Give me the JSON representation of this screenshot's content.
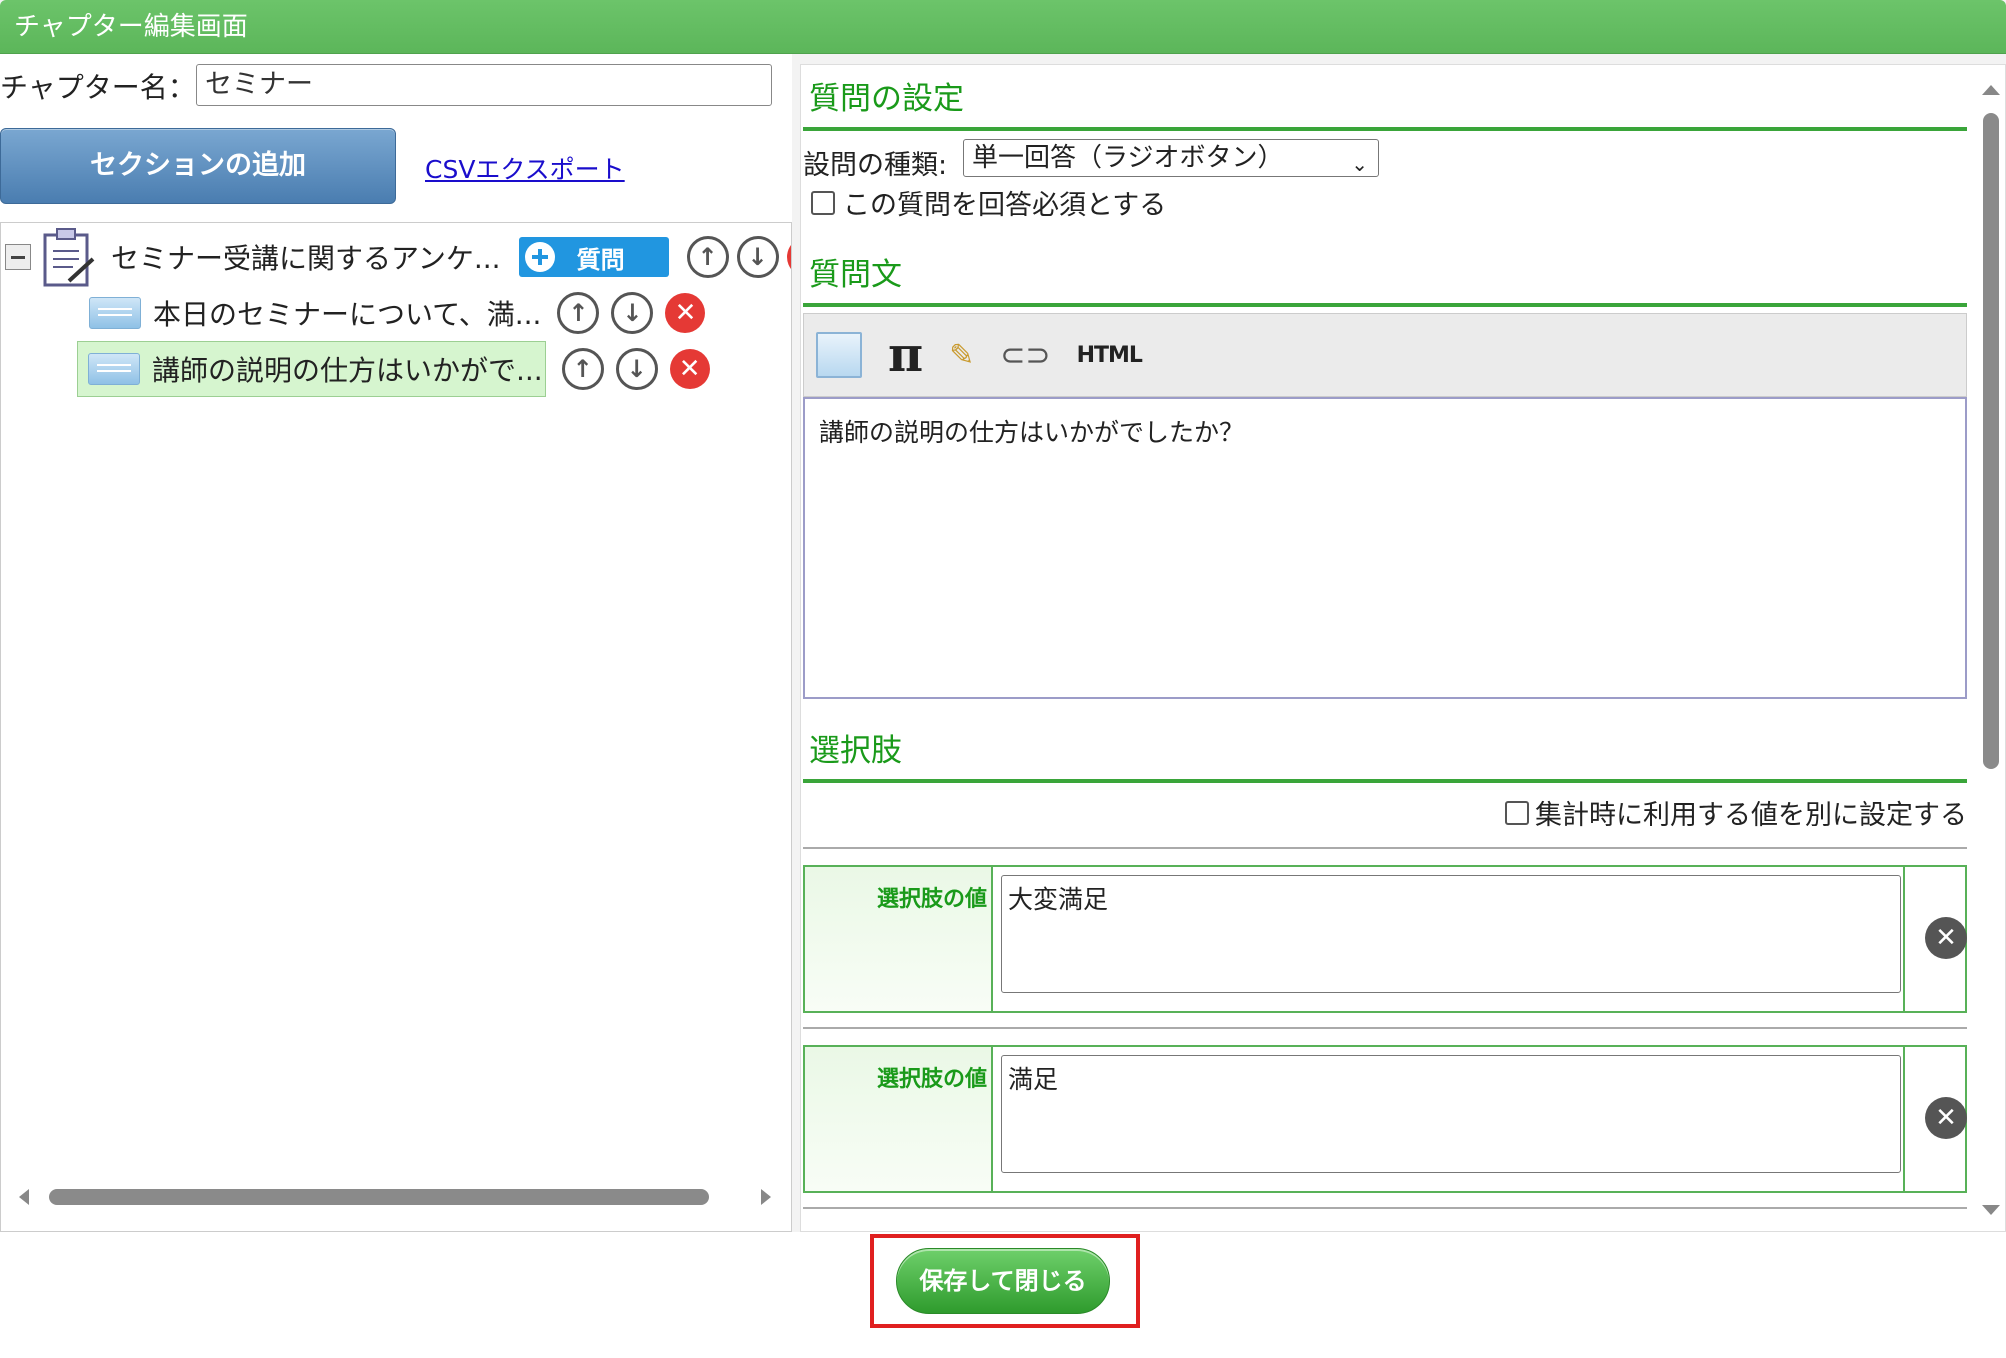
{
  "window": {
    "title": "チャプター編集画面"
  },
  "chapter": {
    "label": "チャプター名：",
    "value": "セミナー"
  },
  "toolbar": {
    "add_section": "セクションの追加",
    "csv_export": "CSVエクスポート"
  },
  "tree": {
    "root": {
      "label": "セミナー受講に関するアンケ...",
      "add_question": "質問"
    },
    "items": [
      {
        "label": "本日のセミナーについて、満..."
      },
      {
        "label": "講師の説明の仕方はいかがで..."
      }
    ]
  },
  "question": {
    "settings_title": "質問の設定",
    "type_label": "設問の種類:",
    "type_value": "単一回答（ラジオボタン）",
    "required_label": "この質問を回答必須とする",
    "text_title": "質問文",
    "text_value": "講師の説明の仕方はいかがでしたか？",
    "editor_html": "HTML",
    "choices_title": "選択肢",
    "agg_label": "集計時に利用する値を別に設定する",
    "choice_value_label": "選択肢の値",
    "choices": [
      "大変満足",
      "満足"
    ]
  },
  "footer": {
    "save_close": "保存して閉じる"
  },
  "colors": {
    "accent_green": "#1a9a1a",
    "title_bar": "#5cb65a",
    "highlight": "#e02020"
  }
}
